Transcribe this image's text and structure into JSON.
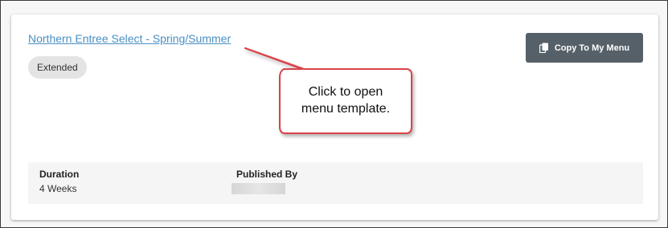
{
  "template": {
    "title": "Northern Entree Select - Spring/Summer",
    "badge": "Extended",
    "copy_button_label": "Copy To My Menu",
    "copy_button_icon": "copy-icon"
  },
  "details": {
    "duration_label": "Duration",
    "duration_value": "4 Weeks",
    "published_by_label": "Published By",
    "published_by_value_redacted": true
  },
  "callout": {
    "text_line1": "Click to open",
    "text_line2": "menu template."
  },
  "colors": {
    "link": "#4a8fc2",
    "button_bg": "#556068",
    "callout_border": "#d9434a",
    "badge_bg": "#e4e4e4"
  }
}
